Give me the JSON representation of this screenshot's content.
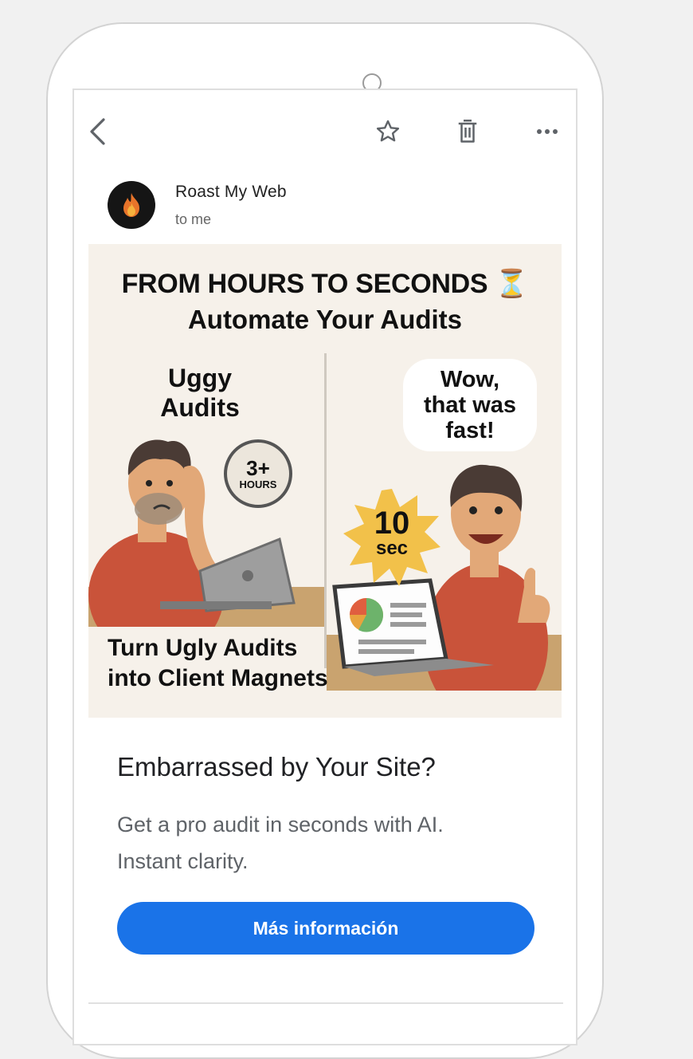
{
  "toolbar": {
    "icons": [
      "back-arrow-icon",
      "star-icon",
      "trash-icon",
      "more-icon"
    ]
  },
  "email": {
    "sender_name": "Roast My Web",
    "recipient": "to me",
    "avatar_icon": "flame-icon"
  },
  "banner": {
    "title": "FROM HOURS TO SECONDS ⏳",
    "subtitle": "Automate Your Audits",
    "left_label_line1": "Uggy",
    "left_label_line2": "Audits",
    "clock_value": "3+",
    "clock_unit": "HOURS",
    "bubble_line1": "Wow,",
    "bubble_line2": "that was",
    "bubble_line3": "fast!",
    "burst_value": "10",
    "burst_unit": "sec",
    "bottom_line1": "Turn Ugly Audits",
    "bottom_line2": "into Client Magnets"
  },
  "content": {
    "heading": "Embarrassed by Your Site?",
    "body_line1": "Get a pro audit in seconds with AI.",
    "body_line2": "Instant clarity.",
    "cta_label": "Más información"
  },
  "colors": {
    "accent": "#1a73e8",
    "banner_bg": "#f6f1ea",
    "burst": "#f2c14a",
    "shirt": "#c9533a"
  }
}
